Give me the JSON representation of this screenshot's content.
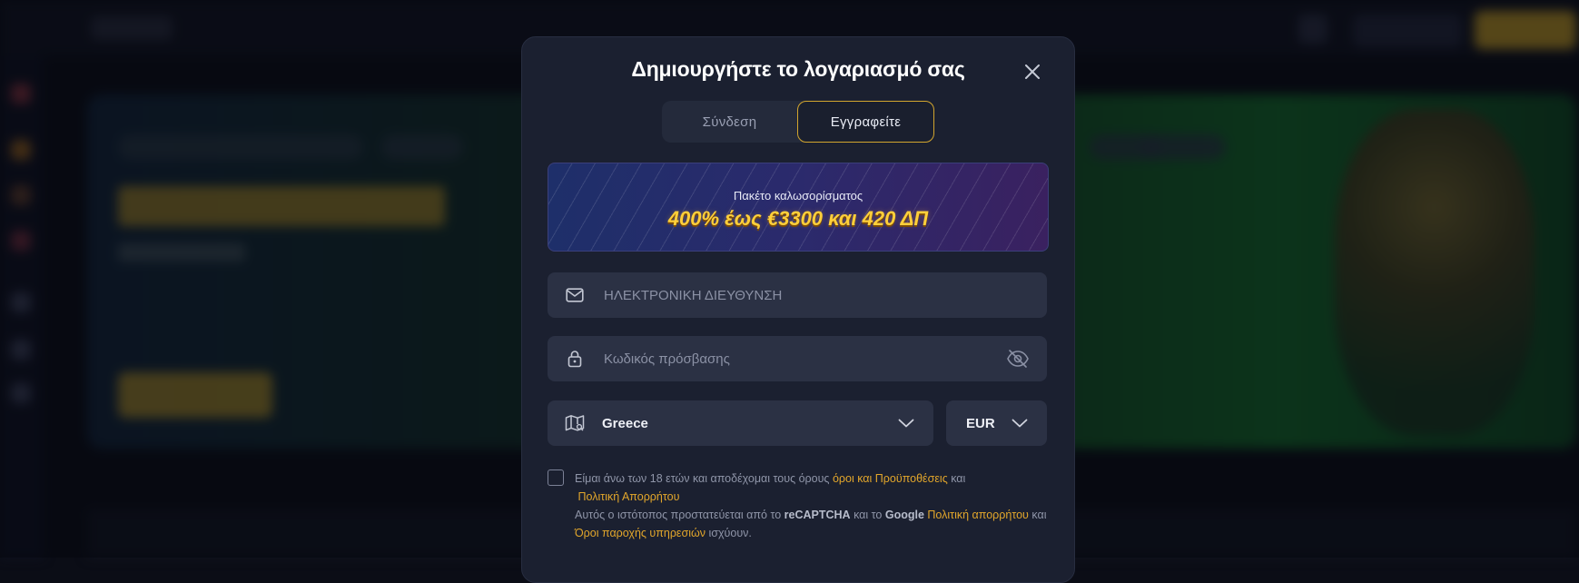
{
  "modal": {
    "title": "Δημιουργήστε το λογαριασμό σας",
    "tabs": [
      {
        "label": "Σύνδεση",
        "active": false
      },
      {
        "label": "Εγγραφείτε",
        "active": true
      }
    ],
    "promo": {
      "caption": "Πακέτο καλωσορίσματος",
      "offer": "400% έως €3300 και 420 ΔΠ"
    },
    "email": {
      "placeholder": "ΗΛΕΚΤΡΟΝΙΚΗ ΔΙΕΥΘΥΝΣΗ",
      "value": ""
    },
    "password": {
      "placeholder": "Κωδικός πρόσβασης",
      "value": ""
    },
    "country": {
      "value": "Greece"
    },
    "currency": {
      "value": "EUR"
    },
    "consent": {
      "checked": false,
      "text1": "Είμαι άνω των 18 ετών και αποδέχομαι τους όρους",
      "terms_link": "όροι και Προϋποθέσεις",
      "and1": "και",
      "privacy_link": "Πολιτική Απορρήτου",
      "recaptcha_pre": "Αυτός ο ιστότοπος προστατεύεται από το",
      "recaptcha": "reCAPTCHA",
      "and2": "και το",
      "google": "Google",
      "google_privacy_link": "Πολιτική απορρήτου",
      "and3": "και",
      "google_terms_link": "Όροι παροχής υπηρεσιών",
      "apply": "ισχύουν."
    }
  },
  "colors": {
    "modal_bg": "#1b2030",
    "field_bg": "#2b3144",
    "accent_gold": "#d2a52e",
    "link": "#e2a62b",
    "offer_text": "#ffcf3a"
  },
  "icons": [
    "close-icon",
    "mail-icon",
    "lock-icon",
    "eye-off-icon",
    "map-icon",
    "chevron-down-icon"
  ]
}
